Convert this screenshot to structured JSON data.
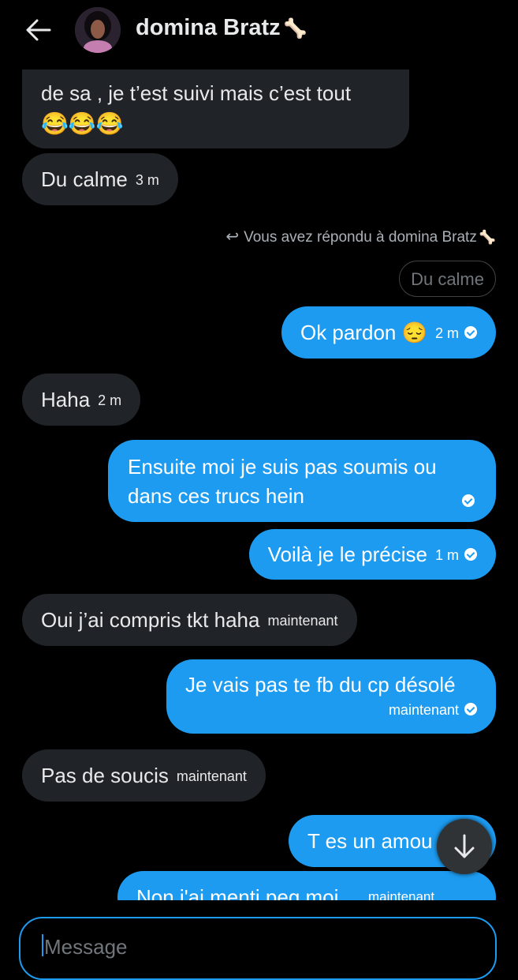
{
  "header": {
    "contact_name": "domina Bratz",
    "name_emoji": "🦴"
  },
  "messages": [
    {
      "text_line1": "de sa , je t’est suivi mais c’est tout",
      "text_line2": "😂😂😂"
    },
    {
      "text": "Du calme",
      "time": "3 m"
    },
    {
      "reply_note": "Vous avez répondu à domina Bratz",
      "reply_emoji": "🦴",
      "quoted": "Du calme"
    },
    {
      "text": "Ok pardon 😔",
      "time": "2 m"
    },
    {
      "text": "Haha",
      "time": "2 m"
    },
    {
      "text_line1": "Ensuite moi je suis pas soumis ou",
      "text_line2": "dans ces trucs hein"
    },
    {
      "text": "Voilà je le précise",
      "time": "1 m"
    },
    {
      "text": "Oui j’ai compris tkt haha",
      "time": "maintenant"
    },
    {
      "text": "Je vais pas te fb du cp désolé",
      "time": "maintenant"
    },
    {
      "text": "Pas de soucis",
      "time": "maintenant"
    },
    {
      "text": "T es un amou"
    },
    {
      "text": "Non j'ai menti peg moi",
      "time": "maintenant"
    }
  ],
  "composer": {
    "placeholder": "Message"
  }
}
